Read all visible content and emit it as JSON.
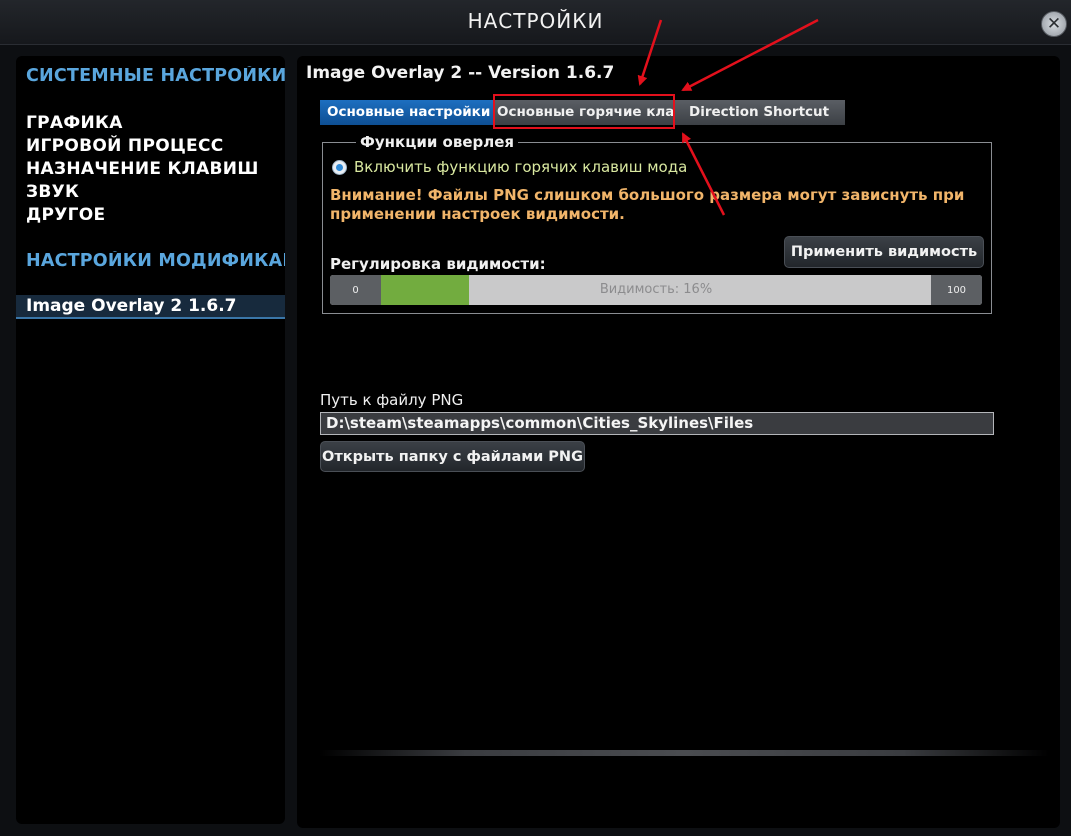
{
  "window": {
    "title": "НАСТРОЙКИ",
    "close_glyph": "✕"
  },
  "sidebar": {
    "system_header": "СИСТЕМНЫЕ НАСТРОЙКИ",
    "items": [
      "ГРАФИКА",
      "ИГРОВОЙ ПРОЦЕСС",
      "НАЗНАЧЕНИЕ КЛАВИШ",
      "ЗВУК",
      "ДРУГОЕ"
    ],
    "mods_header": "НАСТРОЙКИ МОДИФИКАЦИЙ",
    "selected_mod": "Image Overlay 2 1.6.7"
  },
  "main": {
    "mod_title": "Image Overlay 2 -- Version 1.6.7",
    "tabs": [
      {
        "label": "Основные настройки",
        "active": true
      },
      {
        "label": "Основные горячие клавиши",
        "active": false
      },
      {
        "label": "Direction Shortcut",
        "active": false
      }
    ],
    "overlay_group": {
      "legend": "Функции оверлея",
      "radio_label": "Включить функцию горячих клавиш мода",
      "radio_checked": true,
      "warning": "Внимание! Файлы PNG слишком большого размера могут зависнуть при применении настроек видимости.",
      "apply_button": "Применить видимость",
      "visibility_label": "Регулировка видимости:",
      "slider": {
        "min_label": "0",
        "max_label": "100",
        "value_text": "Видимость: 16%",
        "value": 16
      }
    },
    "path_label": "Путь к файлу PNG",
    "path_value": "D:\\steam\\steamapps\\common\\Cities_Skylines\\Files",
    "open_folder_button": "Открыть папку с файлами PNG"
  },
  "colors": {
    "accent_blue": "#5aa6dd",
    "tab_active": "#1565b3",
    "warning": "#f1b56a",
    "slider_fill": "#72ac3f",
    "annotation_red": "#e3101c"
  },
  "icons": {
    "close": "close-icon",
    "radio": "radio-icon"
  }
}
